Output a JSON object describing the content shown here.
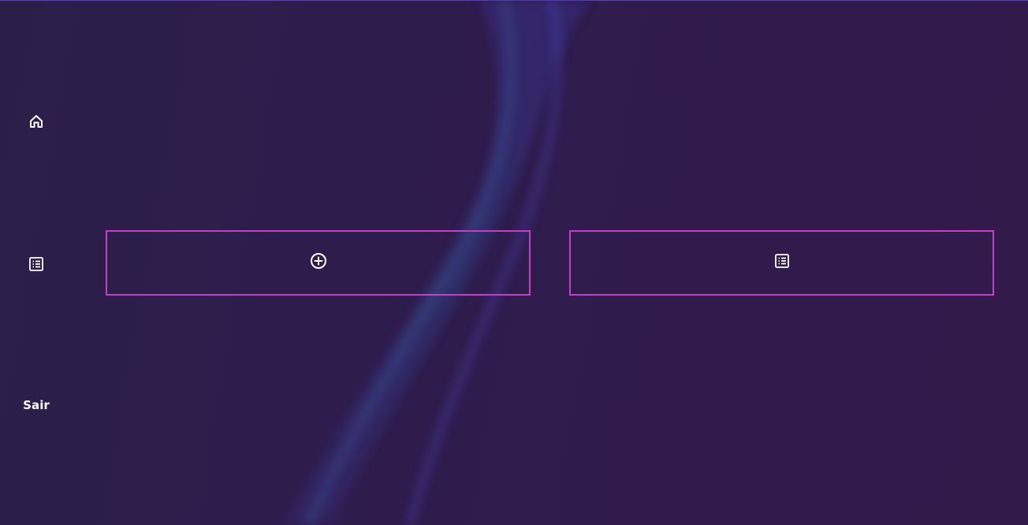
{
  "sidebar": {
    "items": [
      {
        "icon": "home-icon"
      },
      {
        "icon": "list-icon"
      },
      {
        "label": "Sair"
      }
    ]
  },
  "main": {
    "buttons": [
      {
        "icon": "plus-circle-icon"
      },
      {
        "icon": "list-icon"
      }
    ]
  },
  "colors": {
    "background": "#2d1d4b",
    "button_border": "#c23fc6",
    "wave": "#4a4ac0",
    "text": "#ffffff"
  }
}
